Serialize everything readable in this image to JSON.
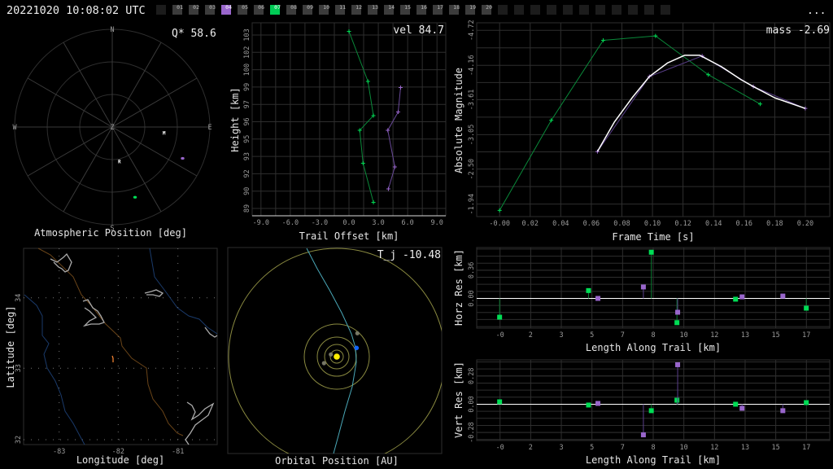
{
  "header": {
    "timestamp": "20221020 10:08:02 UTC",
    "frames": [
      "01",
      "02",
      "03",
      "04",
      "05",
      "06",
      "07",
      "08",
      "09",
      "10",
      "11",
      "12",
      "13",
      "14",
      "15",
      "16",
      "17",
      "18",
      "19",
      "20"
    ],
    "selected_frames": {
      "04": "#9966cc",
      "07": "#00cc55"
    },
    "menu_label": "..."
  },
  "colors": {
    "station_green": "#00dd55",
    "station_purple": "#9966cc",
    "fit": "#ffffff",
    "zero_line": "#ffffff"
  },
  "chart_data": [
    {
      "id": "atmospheric",
      "type": "polar-scatter",
      "title": "Atmospheric Position [deg]",
      "annotation": "Q* 58.6",
      "compass": {
        "N": "N",
        "E": "E",
        "S": "S",
        "W": "W",
        "center": "Z"
      },
      "altitude_rings": [
        60,
        30,
        0
      ],
      "stations": [
        {
          "label": "M",
          "az": 96,
          "alt": 42
        },
        {
          "label": "R",
          "az": 168,
          "alt": 58
        }
      ],
      "tracks": [
        {
          "color": "#00dd55",
          "az": 162,
          "alt": 22
        },
        {
          "color": "#9966cc",
          "az": 114,
          "alt": 19
        }
      ]
    },
    {
      "id": "trail",
      "type": "line",
      "annotation": "vel 84.7",
      "xlabel": "Trail Offset [km]",
      "ylabel": "Height [km]",
      "xticks": [
        "-9.0",
        "-6.0",
        "-3.0",
        "0.0",
        "3.0",
        "6.0",
        "9.0"
      ],
      "yticks": [
        "89",
        "90",
        "92",
        "93",
        "95",
        "96",
        "97",
        "99",
        "100",
        "102",
        "103"
      ],
      "xlim": [
        -9.9,
        9.9
      ],
      "ylim": [
        88.5,
        104.3
      ],
      "series": [
        {
          "color": "#00dd55",
          "x": [
            0.0,
            1.94,
            2.5,
            1.1,
            1.44,
            2.5
          ],
          "y": [
            103.6,
            99.5,
            96.7,
            95.5,
            92.8,
            89.6
          ]
        },
        {
          "color": "#9966cc",
          "x": [
            5.28,
            5.03,
            3.97,
            4.69,
            4.03
          ],
          "y": [
            99.0,
            97.0,
            95.5,
            92.5,
            90.7
          ]
        }
      ]
    },
    {
      "id": "lightcurve",
      "type": "line",
      "annotation": "mass -2.69",
      "xlabel": "Frame Time [s]",
      "ylabel": "Absolute Magnitude",
      "xticks": [
        "-0.00",
        "0.02",
        "0.04",
        "0.06",
        "0.08",
        "0.10",
        "0.12",
        "0.14",
        "0.16",
        "0.18",
        "0.20"
      ],
      "yticks": [
        "-4.72",
        "-4.16",
        "-3.61",
        "-3.05",
        "-2.50",
        "-1.94"
      ],
      "xlim": [
        -0.015,
        0.216
      ],
      "ylim": [
        -4.84,
        -1.74
      ],
      "y_inverted": true,
      "series": [
        {
          "color": "#00dd55",
          "x": [
            0.0,
            0.0338,
            0.0678,
            0.102,
            0.1365,
            0.1705
          ],
          "y": [
            -1.84,
            -3.28,
            -4.56,
            -4.63,
            -4.01,
            -3.54
          ]
        },
        {
          "color": "#9966cc",
          "x": [
            0.064,
            0.098,
            0.1325,
            0.166,
            0.2
          ],
          "y": [
            -2.78,
            -3.98,
            -4.31,
            -3.82,
            -3.47
          ]
        }
      ],
      "fit": {
        "color": "#ffffff",
        "x": [
          0.064,
          0.075,
          0.087,
          0.098,
          0.11,
          0.121,
          0.131,
          0.145,
          0.158,
          0.166,
          0.18,
          0.2
        ],
        "y": [
          -2.78,
          -3.25,
          -3.65,
          -3.98,
          -4.2,
          -4.32,
          -4.32,
          -4.14,
          -3.93,
          -3.82,
          -3.64,
          -3.47
        ]
      }
    },
    {
      "id": "horz_res",
      "type": "stem",
      "xlabel": "Length Along Trail [km]",
      "ylabel": "Horz Res [km]",
      "xticks": [
        "-0",
        "2",
        "3",
        "5",
        "7",
        "8",
        "10",
        "12",
        "13",
        "15",
        "17"
      ],
      "yticks": [
        "0.00",
        "0.36"
      ],
      "xlim": [
        -1.27,
        18.3
      ],
      "ylim": [
        -0.38,
        0.65
      ],
      "series": [
        {
          "color": "#00dd55",
          "x": [
            0,
            4.93,
            8.41,
            9.83,
            13.08,
            17.0
          ],
          "y": [
            -0.24,
            0.1,
            0.59,
            -0.31,
            -0.01,
            -0.125
          ]
        },
        {
          "color": "#9966cc",
          "x": [
            5.45,
            7.97,
            9.87,
            13.44,
            15.7
          ],
          "y": [
            0.0,
            0.146,
            -0.177,
            0.02,
            0.03
          ]
        }
      ]
    },
    {
      "id": "vert_res",
      "type": "stem",
      "xlabel": "Length Along Trail [km]",
      "ylabel": "Vert Res [km]",
      "xticks": [
        "-0",
        "2",
        "3",
        "5",
        "7",
        "8",
        "10",
        "12",
        "13",
        "15",
        "17"
      ],
      "yticks": [
        "-0.28",
        "0.00",
        "0.28"
      ],
      "xlim": [
        -1.27,
        18.3
      ],
      "ylim": [
        -0.36,
        0.44
      ],
      "series": [
        {
          "color": "#00dd55",
          "x": [
            0,
            4.93,
            8.41,
            9.83,
            13.08,
            17.0
          ],
          "y": [
            0.024,
            -0.008,
            -0.064,
            0.04,
            0.0,
            0.016
          ]
        },
        {
          "color": "#9966cc",
          "x": [
            5.45,
            7.97,
            9.87,
            13.44,
            15.7
          ],
          "y": [
            0.008,
            -0.304,
            0.392,
            -0.04,
            -0.064
          ]
        }
      ]
    },
    {
      "id": "map",
      "type": "map",
      "xlabel": "Longitude [deg]",
      "ylabel": "Latitude [deg]",
      "xticks": [
        "-83",
        "-82",
        "-81"
      ],
      "yticks": [
        "32",
        "33",
        "34"
      ],
      "trail_color": "#ff8833"
    },
    {
      "id": "orbit",
      "type": "orbit",
      "title": "Orbital Position [AU]",
      "annotation": "T_j -10.48",
      "orbit_color": "#8a8a40",
      "trajectory_color": "#4aa8b8",
      "sun_color": "#ffee00",
      "earth_color": "#1166ff",
      "planet_color": "#777766"
    }
  ]
}
